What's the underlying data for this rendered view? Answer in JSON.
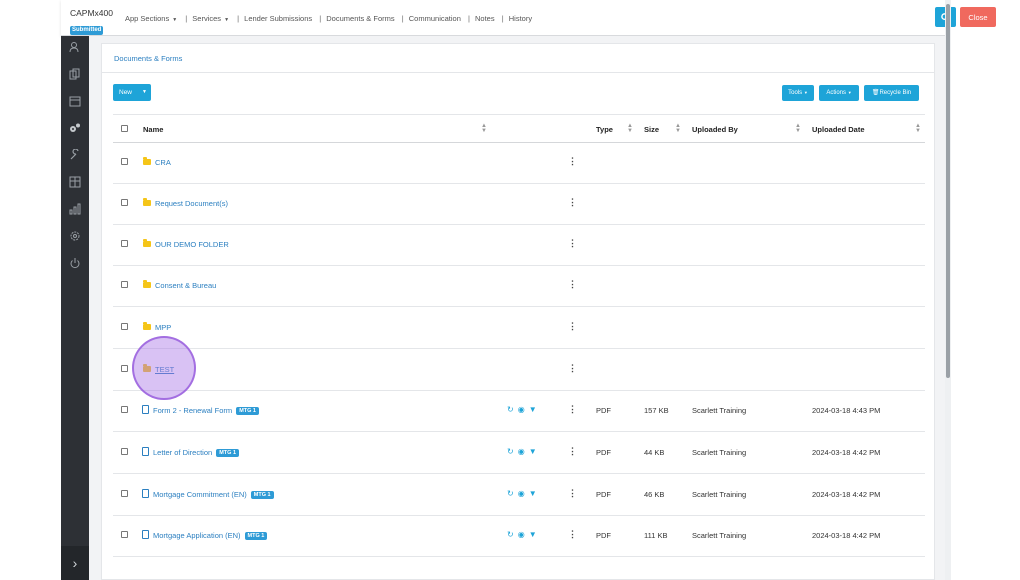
{
  "app": {
    "name": "CAPMx400",
    "status_badge": "Submitted",
    "nav": [
      "App Sections",
      "Services",
      "Lender Submissions",
      "Documents & Forms",
      "Communication",
      "Notes",
      "History"
    ],
    "close_label": "Close"
  },
  "sidebar": {
    "icons": [
      "users-icon",
      "copy-icon",
      "calendar-icon",
      "gears-icon",
      "wrench-icon",
      "table-icon",
      "bar-chart-icon",
      "settings-icon",
      "power-icon"
    ],
    "expand_icon": "chevron-right-icon"
  },
  "section": {
    "title": "Documents & Forms"
  },
  "toolbar": {
    "new_label": "New",
    "tools_label": "Tools",
    "actions_label": "Actions",
    "recycle_label": "Recycle Bin"
  },
  "table": {
    "headers": {
      "name": "Name",
      "type": "Type",
      "size": "Size",
      "uploaded_by": "Uploaded By",
      "uploaded_date": "Uploaded Date"
    },
    "folders": [
      {
        "name": "CRA"
      },
      {
        "name": "Request Document(s)"
      },
      {
        "name": "OUR DEMO FOLDER"
      },
      {
        "name": "Consent & Bureau"
      },
      {
        "name": "MPP"
      },
      {
        "name": "TEST"
      }
    ],
    "files": [
      {
        "name": "Form 2 - Renewal Form",
        "badge": "MTG 1",
        "type": "PDF",
        "size": "157 KB",
        "uploaded_by": "Scarlett Training",
        "uploaded_date": "2024-03-18 4:43 PM"
      },
      {
        "name": "Letter of Direction",
        "badge": "MTG 1",
        "type": "PDF",
        "size": "44 KB",
        "uploaded_by": "Scarlett Training",
        "uploaded_date": "2024-03-18 4:42 PM"
      },
      {
        "name": "Mortgage Commitment (EN)",
        "badge": "MTG 1",
        "type": "PDF",
        "size": "46 KB",
        "uploaded_by": "Scarlett Training",
        "uploaded_date": "2024-03-18 4:42 PM"
      },
      {
        "name": "Mortgage Application (EN)",
        "badge": "MTG 1",
        "type": "PDF",
        "size": "111 KB",
        "uploaded_by": "Scarlett Training",
        "uploaded_date": "2024-03-18 4:42 PM"
      }
    ]
  },
  "colors": {
    "accent": "#1ea4d8",
    "danger": "#f0695e",
    "link": "#2b7fc0",
    "folder": "#f5c518",
    "sidebar": "#2d3035",
    "highlight": "#aa78e6"
  }
}
